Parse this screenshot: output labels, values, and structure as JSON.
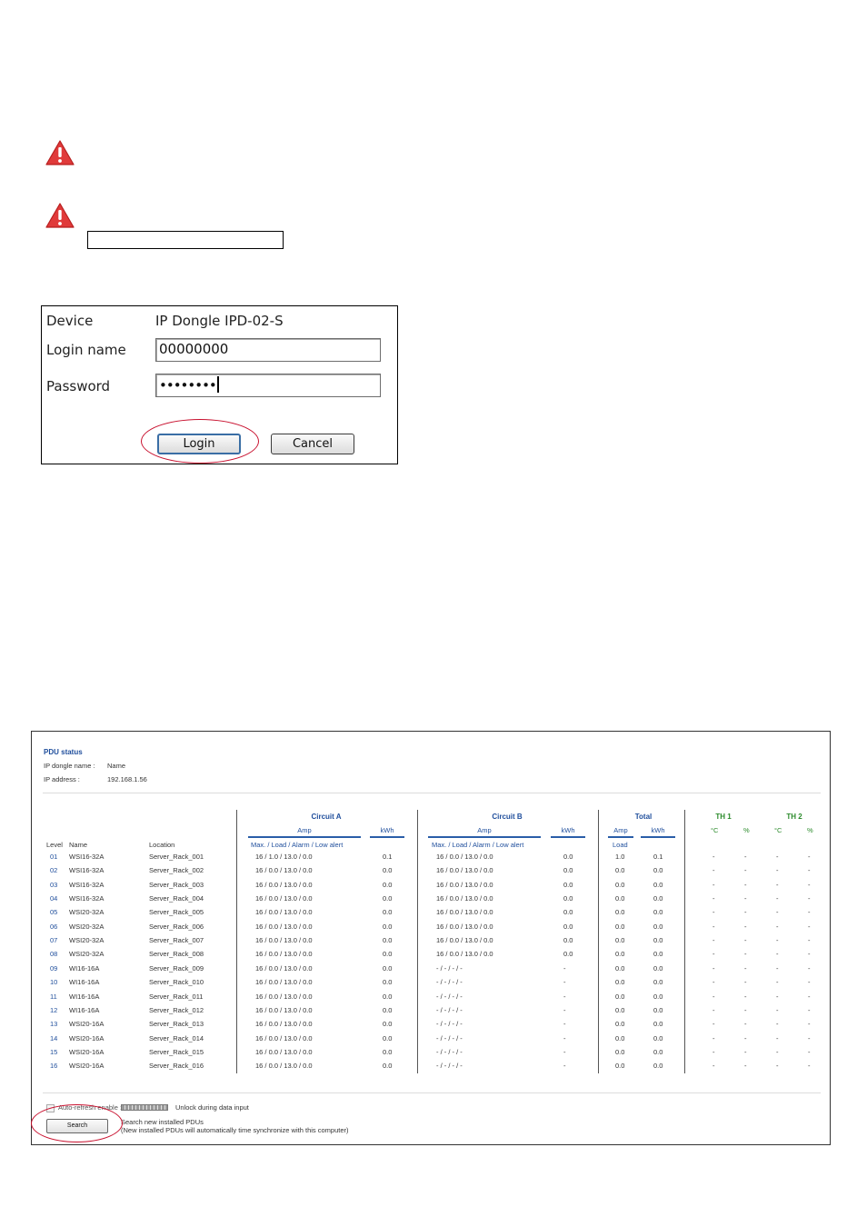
{
  "login": {
    "device_label": "Device",
    "device_value": "IP Dongle IPD-02-S",
    "login_label": "Login name",
    "login_value": "00000000",
    "password_label": "Password",
    "password_value": "••••••••",
    "login_button": "Login",
    "cancel_button": "Cancel"
  },
  "pdu": {
    "title": "PDU status",
    "dongle_name_label": "IP dongle name :",
    "dongle_name_value": "Name",
    "ip_label": "IP address :",
    "ip_value": "192.168.1.56",
    "circuit_a": "Circuit   A",
    "circuit_b": "Circuit   B",
    "total": "Total",
    "th1": "TH   1",
    "th2": "TH   2",
    "amp": "Amp",
    "kwh": "kWh",
    "celsius": "°C",
    "percent": "%",
    "col_level": "Level",
    "col_name": "Name",
    "col_location": "Location",
    "sub_a": "Max.  /  Load  / Alarm / Low alert",
    "sub_b": "Max.  /  Load  / Alarm / Low alert",
    "load": "Load",
    "rows": [
      {
        "level": "01",
        "name": "WSI16-32A",
        "location": "Server_Rack_001",
        "a": "16   /   1.0   /  13.0  /     0.0",
        "akwh": "0.1",
        "b": "16   /   0.0   /  13.0  /     0.0",
        "bkwh": "0.0",
        "tload": "1.0",
        "tkwh": "0.1"
      },
      {
        "level": "02",
        "name": "WSI16-32A",
        "location": "Server_Rack_002",
        "a": "16   /   0.0   /  13.0  /     0.0",
        "akwh": "0.0",
        "b": "16   /   0.0   /  13.0  /     0.0",
        "bkwh": "0.0",
        "tload": "0.0",
        "tkwh": "0.0"
      },
      {
        "level": "03",
        "name": "WSI16-32A",
        "location": "Server_Rack_003",
        "a": "16   /   0.0   /  13.0  /     0.0",
        "akwh": "0.0",
        "b": "16   /   0.0   /  13.0  /     0.0",
        "bkwh": "0.0",
        "tload": "0.0",
        "tkwh": "0.0"
      },
      {
        "level": "04",
        "name": "WSI16-32A",
        "location": "Server_Rack_004",
        "a": "16   /   0.0   /  13.0  /     0.0",
        "akwh": "0.0",
        "b": "16   /   0.0   /  13.0  /     0.0",
        "bkwh": "0.0",
        "tload": "0.0",
        "tkwh": "0.0"
      },
      {
        "level": "05",
        "name": "WSI20-32A",
        "location": "Server_Rack_005",
        "a": "16   /   0.0   /  13.0  /     0.0",
        "akwh": "0.0",
        "b": "16   /   0.0   /  13.0  /     0.0",
        "bkwh": "0.0",
        "tload": "0.0",
        "tkwh": "0.0"
      },
      {
        "level": "06",
        "name": "WSI20-32A",
        "location": "Server_Rack_006",
        "a": "16   /   0.0   /  13.0  /     0.0",
        "akwh": "0.0",
        "b": "16   /   0.0   /  13.0  /     0.0",
        "bkwh": "0.0",
        "tload": "0.0",
        "tkwh": "0.0"
      },
      {
        "level": "07",
        "name": "WSI20-32A",
        "location": "Server_Rack_007",
        "a": "16   /   0.0   /  13.0  /     0.0",
        "akwh": "0.0",
        "b": "16   /   0.0   /  13.0  /     0.0",
        "bkwh": "0.0",
        "tload": "0.0",
        "tkwh": "0.0"
      },
      {
        "level": "08",
        "name": "WSI20-32A",
        "location": "Server_Rack_008",
        "a": "16   /   0.0   /  13.0  /     0.0",
        "akwh": "0.0",
        "b": "16   /   0.0   /  13.0  /     0.0",
        "bkwh": "0.0",
        "tload": "0.0",
        "tkwh": "0.0"
      },
      {
        "level": "09",
        "name": "WI16-16A",
        "location": "Server_Rack_009",
        "a": "16   /   0.0   /  13.0  /     0.0",
        "akwh": "0.0",
        "b": "-    /    -    /    -    /      -",
        "bkwh": "-",
        "tload": "0.0",
        "tkwh": "0.0"
      },
      {
        "level": "10",
        "name": "WI16-16A",
        "location": "Server_Rack_010",
        "a": "16   /   0.0   /  13.0  /     0.0",
        "akwh": "0.0",
        "b": "-    /    -    /    -    /      -",
        "bkwh": "-",
        "tload": "0.0",
        "tkwh": "0.0"
      },
      {
        "level": "11",
        "name": "WI16-16A",
        "location": "Server_Rack_011",
        "a": "16   /   0.0   /  13.0  /     0.0",
        "akwh": "0.0",
        "b": "-    /    -    /    -    /      -",
        "bkwh": "-",
        "tload": "0.0",
        "tkwh": "0.0"
      },
      {
        "level": "12",
        "name": "WI16-16A",
        "location": "Server_Rack_012",
        "a": "16   /   0.0   /  13.0  /     0.0",
        "akwh": "0.0",
        "b": "-    /    -    /    -    /      -",
        "bkwh": "-",
        "tload": "0.0",
        "tkwh": "0.0"
      },
      {
        "level": "13",
        "name": "WSI20-16A",
        "location": "Server_Rack_013",
        "a": "16   /   0.0   /  13.0  /     0.0",
        "akwh": "0.0",
        "b": "-    /    -    /    -    /      -",
        "bkwh": "-",
        "tload": "0.0",
        "tkwh": "0.0"
      },
      {
        "level": "14",
        "name": "WSI20-16A",
        "location": "Server_Rack_014",
        "a": "16   /   0.0   /  13.0  /     0.0",
        "akwh": "0.0",
        "b": "-    /    -    /    -    /      -",
        "bkwh": "-",
        "tload": "0.0",
        "tkwh": "0.0"
      },
      {
        "level": "15",
        "name": "WSI20-16A",
        "location": "Server_Rack_015",
        "a": "16   /   0.0   /  13.0  /     0.0",
        "akwh": "0.0",
        "b": "-    /    -    /    -    /      -",
        "bkwh": "-",
        "tload": "0.0",
        "tkwh": "0.0"
      },
      {
        "level": "16",
        "name": "WSI20-16A",
        "location": "Server_Rack_016",
        "a": "16   /   0.0   /  13.0  /     0.0",
        "akwh": "0.0",
        "b": "-    /    -    /    -    /      -",
        "bkwh": "-",
        "tload": "0.0",
        "tkwh": "0.0"
      }
    ],
    "th_dash": "-",
    "auto_refresh_label": "Auto-refresh enable :",
    "unlock_text": "Unlock during data input",
    "search_button": "Search",
    "search_hint_1": "Search new installed PDUs",
    "search_hint_2": "(New installed PDUs will automatically time synchronize with this computer)"
  },
  "colors": {
    "warning_red": "#e03a3a",
    "highlight_red": "#c8102e",
    "pdu_blue": "#1f4e9c",
    "th_green": "#2a8a2a"
  },
  "icons": [
    "warning-icon",
    "warning-icon"
  ]
}
